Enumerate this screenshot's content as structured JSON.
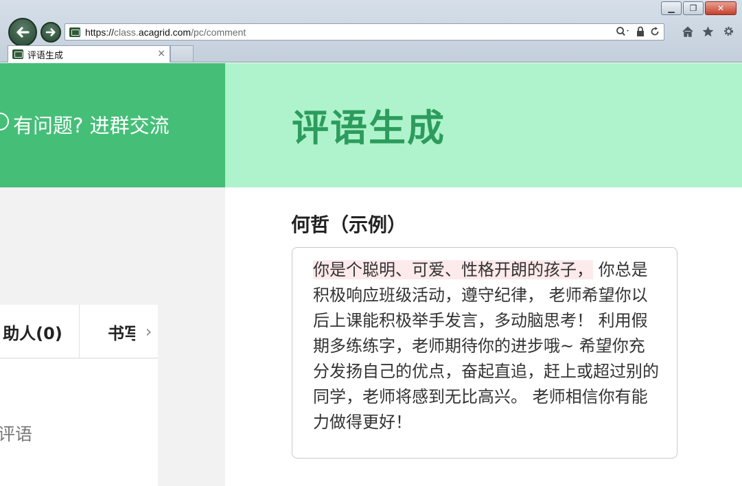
{
  "browser": {
    "url_scheme": "https://",
    "url_host_pre": "class.",
    "url_domain": "acagrid.com",
    "url_path": "/pc/comment",
    "tab_title": "评语生成",
    "tab_close": "×",
    "window_buttons": {
      "minimize": "▁",
      "restore": "❐",
      "close": "✕"
    }
  },
  "sidebar": {
    "help_text": "有问题?  进群交流",
    "tabs": [
      {
        "label": "助人(0)"
      },
      {
        "label": "书写"
      }
    ],
    "tabs_arrow": "›",
    "hint": "生评语"
  },
  "main": {
    "title": "评语生成",
    "student_name": "何哲（示例）",
    "comment_highlight": "你是个聪明、可爱、性格开朗的孩子，",
    "comment_rest": " 你总是积极响应班级活动，遵守纪律， 老师希望你以后上课能积极举手发言，多动脑思考！ 利用假期多练练字，老师期待你的进步哦~ 希望你充分发扬自己的优点，奋起直追，赶上或超过别的同学，老师将感到无比高兴。 老师相信你有能力做得更好！"
  },
  "colors": {
    "left_header": "#45bf78",
    "right_header": "#aef3cc",
    "title": "#2c9c5c"
  },
  "icons": [
    "back-arrow-icon",
    "forward-arrow-icon",
    "site-favicon-icon",
    "search-icon",
    "lock-icon",
    "refresh-icon",
    "home-icon",
    "star-icon",
    "gear-icon",
    "help-icon",
    "chevron-right-icon"
  ]
}
